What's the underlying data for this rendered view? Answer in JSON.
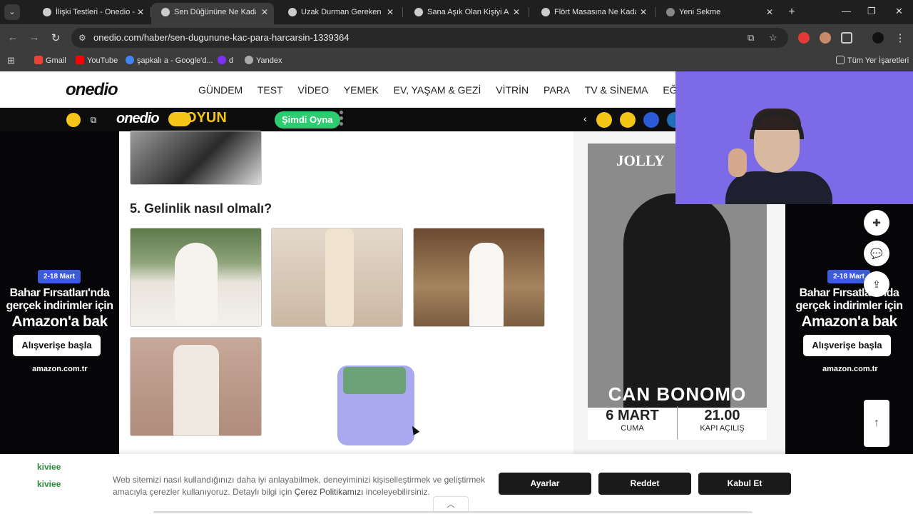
{
  "browser": {
    "tabs": [
      {
        "title": "İlişki Testleri - Onedio - Sayfa",
        "active": false
      },
      {
        "title": "Sen Düğününe Ne Kadar Para",
        "active": true
      },
      {
        "title": "Uzak Durman Gereken Erkek",
        "active": false
      },
      {
        "title": "Sana Aşık Olan Kişiyi Açıkla",
        "active": false
      },
      {
        "title": "Flört Masasına Ne Kadar G",
        "active": false
      },
      {
        "title": "Yeni Sekme",
        "active": false
      }
    ],
    "url": "onedio.com/haber/sen-dugunune-kac-para-harcarsin-1339364",
    "bookmarks": [
      {
        "label": "Gmail",
        "color": "#ea4335"
      },
      {
        "label": "YouTube",
        "color": "#ff0000"
      },
      {
        "label": "şapkalı a - Google'd...",
        "color": "#4285f4"
      },
      {
        "label": "d",
        "color": "#7b2ff7"
      },
      {
        "label": "Yandex",
        "color": "#cccccc"
      }
    ],
    "all_bookmarks_label": "Tüm Yer İşaretleri"
  },
  "site": {
    "logo": "onedio",
    "nav": [
      "GÜNDEM",
      "TEST",
      "VİDEO",
      "YEMEK",
      "EV, YAŞAM & GEZİ",
      "VİTRİN",
      "PARA",
      "TV & SİNEMA",
      "EĞLENCE"
    ],
    "game_bar": {
      "logo": "onedio",
      "oyun": "OYUN",
      "play_label": "Şimdi Oyna"
    }
  },
  "article": {
    "question_heading": "5. Gelinlik nasıl olmalı?"
  },
  "ads": {
    "badge": "2-18 Mart",
    "line1": "Bahar Fırsatları'nda",
    "line2": "gerçek indirimler için",
    "line3": "Amazon'a bak",
    "button": "Alışverişe başla",
    "brand": "amazon.com.tr"
  },
  "sidebar_poster": {
    "brand": "JOLLY",
    "artist": "CAN BONOMO",
    "date": "6 MART",
    "day": "CUMA",
    "time": "21.00",
    "time_sub": "KAPI AÇILIŞ"
  },
  "cookie_banner": {
    "text_part1": "Web sitemizi nasıl kullandığınızı daha iyi anlayabilmek, deneyiminizi kişiselleştirmek ve geliştirmek amacıyla çerezler kullanıyoruz. Detaylı bilgi için ",
    "link": "Çerez Politikamızı",
    "text_part2": " inceleyebilirsiniz.",
    "settings": "Ayarlar",
    "reject": "Reddet",
    "accept": "Kabul Et",
    "brand": "kiviee"
  }
}
